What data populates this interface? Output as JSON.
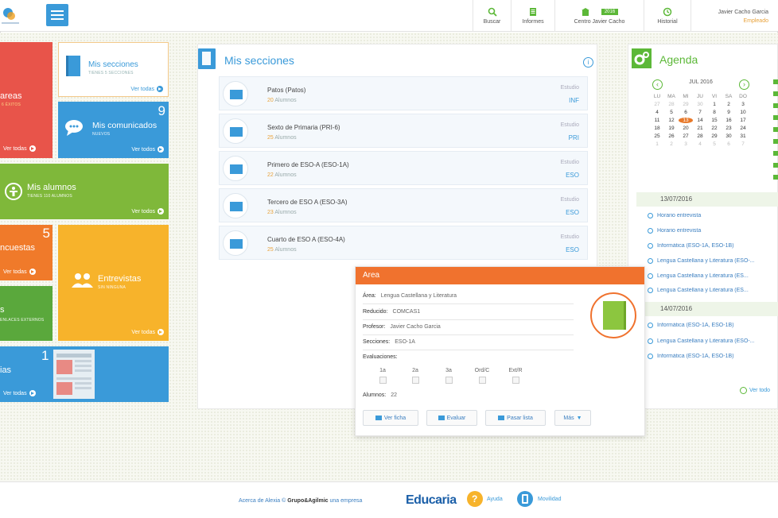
{
  "header": {
    "nav": [
      {
        "label": "Buscar",
        "icon": "search-icon"
      },
      {
        "label": "Informes",
        "icon": "report-icon"
      },
      {
        "label": "Centro Javier Cacho",
        "icon": "school-icon",
        "badge": "2016"
      },
      {
        "label": "Historial",
        "icon": "history-icon"
      }
    ],
    "user_name": "Javier Cacho Garcia",
    "user_role": "Empleado"
  },
  "tiles": {
    "tareas": {
      "title": "areas",
      "sub": "6 ÉXITOS",
      "link": "Ver todas"
    },
    "secciones": {
      "title": "Mis secciones",
      "sub": "TIENES 5 SECCIONES",
      "link": "Ver todas"
    },
    "comunicados": {
      "title": "Mis comunicados",
      "sub": "NUEVOS",
      "count": "9",
      "link": "Ver todos"
    },
    "alumnos": {
      "title": "Mis alumnos",
      "sub": "TIENES 110 ALUMNOS",
      "link": "Ver todos"
    },
    "encuestas": {
      "title": "ncuestas",
      "count": "5",
      "link": "Ver todas"
    },
    "entrevistas": {
      "title": "Entrevistas",
      "sub": "SIN NINGUNA",
      "link": "Ver todas"
    },
    "enlaces": {
      "title": "s",
      "sub": "ENLACES EXTERNOS"
    },
    "noticias": {
      "title": "ias",
      "count": "1",
      "link": "Ver todas"
    }
  },
  "sections": {
    "title": "Mis secciones",
    "rows": [
      {
        "name": "Patos (Patos)",
        "count": "20",
        "alumnos": "Alumnos",
        "est": "Estudio",
        "level": "INF"
      },
      {
        "name": "Sexto de Primaria (PRI-6)",
        "count": "25",
        "alumnos": "Alumnos",
        "est": "Estudio",
        "level": "PRI"
      },
      {
        "name": "Primero de ESO-A (ESO-1A)",
        "count": "22",
        "alumnos": "Alumnos",
        "est": "Estudio",
        "level": "ESO"
      },
      {
        "name": "Tercero de ESO A (ESO-3A)",
        "count": "23",
        "alumnos": "Alumnos",
        "est": "Estudio",
        "level": "ESO"
      },
      {
        "name": "Cuarto de ESO A (ESO-4A)",
        "count": "25",
        "alumnos": "Alumnos",
        "est": "Estudio",
        "level": "ESO"
      }
    ]
  },
  "popup": {
    "title": "Area",
    "area_label": "Área:",
    "area": "Lengua Castellana y Literatura",
    "reducido_label": "Reducido:",
    "reducido": "COMCAS1",
    "profesor_label": "Profesor:",
    "profesor": "Javier Cacho Garcia",
    "secciones_label": "Secciones:",
    "secciones": "ESO-1A",
    "evaluaciones_label": "Evaluaciones:",
    "evals": [
      "1a",
      "2a",
      "3a",
      "Ord/C",
      "Ext/R"
    ],
    "alumnos_label": "Alumnos:",
    "alumnos": "22",
    "buttons": [
      "Ver ficha",
      "Evaluar",
      "Pasar lista",
      "Más"
    ]
  },
  "agenda": {
    "title": "Agenda",
    "month": "JUL 2016",
    "weekdays": [
      "LU",
      "MA",
      "MI",
      "JU",
      "VI",
      "SA",
      "DO"
    ],
    "days": [
      [
        "27",
        "28",
        "29",
        "30",
        "1",
        "2",
        "3"
      ],
      [
        "4",
        "5",
        "6",
        "7",
        "8",
        "9",
        "10"
      ],
      [
        "11",
        "12",
        "13",
        "14",
        "15",
        "16",
        "17"
      ],
      [
        "18",
        "19",
        "20",
        "21",
        "22",
        "23",
        "24"
      ],
      [
        "25",
        "26",
        "27",
        "28",
        "29",
        "30",
        "31"
      ],
      [
        "1",
        "2",
        "3",
        "4",
        "5",
        "6",
        "7"
      ]
    ],
    "today": "13",
    "groups": [
      {
        "date": "13/07/2016",
        "events": [
          "Horario entrevista",
          "Horario entrevista",
          "Informática (ESO-1A, ESO-1B)",
          "Lengua Castellana y Literatura (ESO-...",
          "Lengua Castellana y Literatura (ES...",
          "Lengua Castellana y Literatura (ES..."
        ]
      },
      {
        "date": "14/07/2016",
        "events": [
          "Informática (ESO-1A, ESO-1B)",
          "Lengua Castellana y Literatura (ESO-...",
          "Informática (ESO-1A, ESO-1B)"
        ]
      }
    ],
    "link": "Ver todo"
  },
  "footer": {
    "about": "Acerca de Alexia",
    "company_pre": "Grupo&Agilmic",
    "company_post": "una empresa",
    "brand": "Educaria",
    "help": "Ayuda",
    "mobile": "Movilidad"
  },
  "colors": {
    "blue": "#3a9ad9",
    "green": "#5cb838",
    "orange": "#f0722e",
    "red": "#e8544a",
    "yellow": "#f7b32b"
  }
}
